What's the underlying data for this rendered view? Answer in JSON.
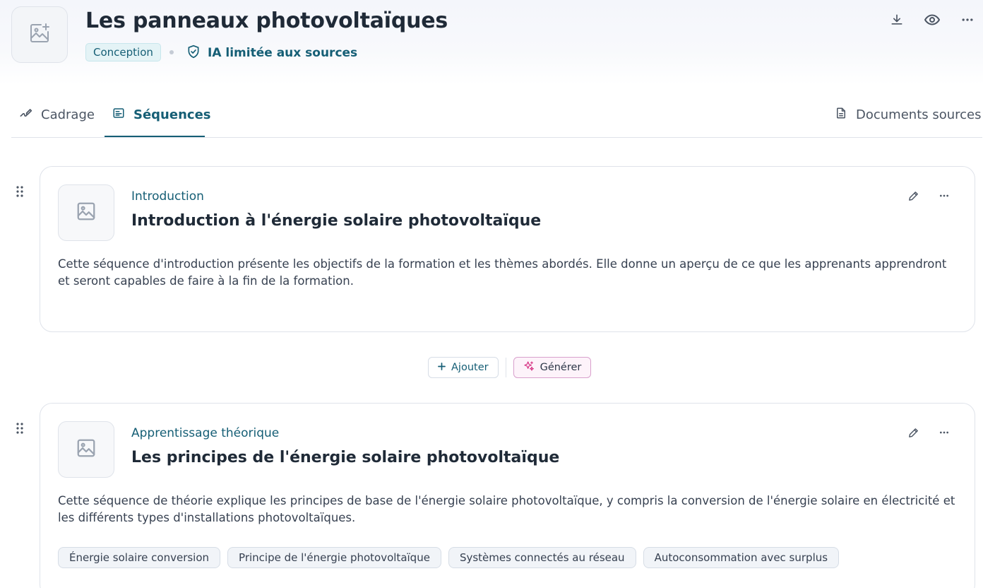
{
  "header": {
    "title": "Les panneaux photovoltaïques",
    "status_badge": "Conception",
    "ai_mode": "IA limitée aux sources",
    "actions": [
      "download-icon",
      "eye-icon",
      "more-icon"
    ]
  },
  "tabs": [
    {
      "label": "Cadrage",
      "icon": "link-pencil-icon",
      "active": false
    },
    {
      "label": "Séquences",
      "icon": "list-icon",
      "active": true
    }
  ],
  "documents_tab": {
    "label": "Documents sources",
    "icon": "document-icon"
  },
  "sequences": [
    {
      "type": "Introduction",
      "title": "Introduction à l'énergie solaire photovoltaïque",
      "description": "Cette séquence d'introduction présente les objectifs de la formation et les thèmes abordés. Elle donne un aperçu de ce que les apprenants apprendront et seront capables de faire à la fin de la formation.",
      "tags": []
    },
    {
      "type": "Apprentissage théorique",
      "title": "Les principes de l'énergie solaire photovoltaïque",
      "description": "Cette séquence de théorie explique les principes de base de l'énergie solaire photovoltaïque, y compris la conversion de l'énergie solaire en électricité et les différents types d'installations photovoltaïques.",
      "tags": [
        "Énergie solaire conversion",
        "Principe de l'énergie photovoltaïque",
        "Systèmes connectés au réseau",
        "Autoconsommation avec surplus"
      ]
    }
  ],
  "insert_actions": {
    "add_label": "Ajouter",
    "generate_label": "Générer"
  },
  "colors": {
    "accent": "#155e75",
    "badge_bg": "#e4f3f6",
    "generate_border": "#d8a0cc",
    "generate_icon": "#d63384",
    "border": "#dfe3ea"
  }
}
